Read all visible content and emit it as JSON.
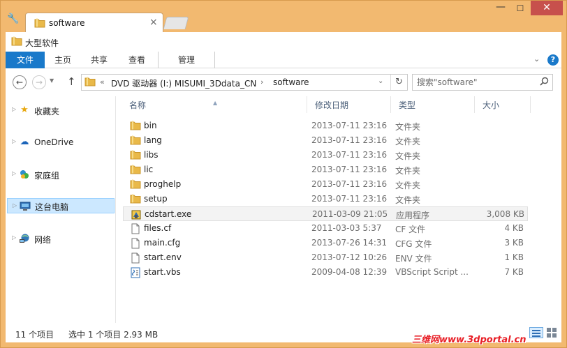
{
  "window": {
    "tab_title": "software",
    "path_title": "大型软件",
    "close_tab_glyph": "×",
    "min_glyph": "—",
    "max_glyph": "☐",
    "close_glyph": "✕"
  },
  "ribbon": {
    "tabs": [
      "文件",
      "主页",
      "共享",
      "查看",
      "管理"
    ],
    "help_glyph": "?"
  },
  "address": {
    "prefix": "«",
    "crumbs": [
      "DVD 驱动器 (I:) MISUMI_3Ddata_CN",
      "software"
    ],
    "separator": "›",
    "refresh_glyph": "↻"
  },
  "search": {
    "placeholder": "搜索\"software\""
  },
  "sidebar": {
    "items": [
      {
        "label": "收藏夹",
        "icon": "star-icon",
        "glyph": "★",
        "color": "#e8a80f"
      },
      {
        "label": "OneDrive",
        "icon": "cloud-icon",
        "glyph": "☁",
        "color": "#1b64b9"
      },
      {
        "label": "家庭组",
        "icon": "homegroup-icon",
        "glyph": "●",
        "color": "#2e8ecf"
      },
      {
        "label": "这台电脑",
        "icon": "computer-icon",
        "glyph": "▣",
        "color": "#2f6fb5"
      },
      {
        "label": "网络",
        "icon": "network-icon",
        "glyph": "▦",
        "color": "#3178b8"
      }
    ],
    "selected_index": 3
  },
  "columns": {
    "name": "名称",
    "date": "修改日期",
    "type": "类型",
    "size": "大小"
  },
  "files": [
    {
      "name": "bin",
      "date": "2013-07-11 23:16",
      "type": "文件夹",
      "size": "",
      "icon": "folder-icon"
    },
    {
      "name": "lang",
      "date": "2013-07-11 23:16",
      "type": "文件夹",
      "size": "",
      "icon": "folder-icon"
    },
    {
      "name": "libs",
      "date": "2013-07-11 23:16",
      "type": "文件夹",
      "size": "",
      "icon": "folder-icon"
    },
    {
      "name": "lic",
      "date": "2013-07-11 23:16",
      "type": "文件夹",
      "size": "",
      "icon": "folder-icon"
    },
    {
      "name": "proghelp",
      "date": "2013-07-11 23:16",
      "type": "文件夹",
      "size": "",
      "icon": "folder-icon"
    },
    {
      "name": "setup",
      "date": "2013-07-11 23:16",
      "type": "文件夹",
      "size": "",
      "icon": "folder-icon"
    },
    {
      "name": "cdstart.exe",
      "date": "2011-03-09 21:05",
      "type": "应用程序",
      "size": "3,008 KB",
      "icon": "exe-icon"
    },
    {
      "name": "files.cf",
      "date": "2011-03-03 5:37",
      "type": "CF 文件",
      "size": "4 KB",
      "icon": "file-icon"
    },
    {
      "name": "main.cfg",
      "date": "2013-07-26 14:31",
      "type": "CFG 文件",
      "size": "3 KB",
      "icon": "file-icon"
    },
    {
      "name": "start.env",
      "date": "2013-07-12 10:26",
      "type": "ENV 文件",
      "size": "1 KB",
      "icon": "file-icon"
    },
    {
      "name": "start.vbs",
      "date": "2009-04-08 12:39",
      "type": "VBScript Script ...",
      "size": "7 KB",
      "icon": "script-icon"
    }
  ],
  "selected_file_index": 6,
  "status": {
    "count": "11 个项目",
    "selection": "选中 1 个项目  2.93 MB"
  },
  "watermark": "三维网www.3dportal.cn",
  "colors": {
    "frame": "#f2b970",
    "accent": "#1979ca",
    "close": "#c7504c",
    "folder": "#e9b949",
    "selected_nav": "#cce8ff"
  }
}
